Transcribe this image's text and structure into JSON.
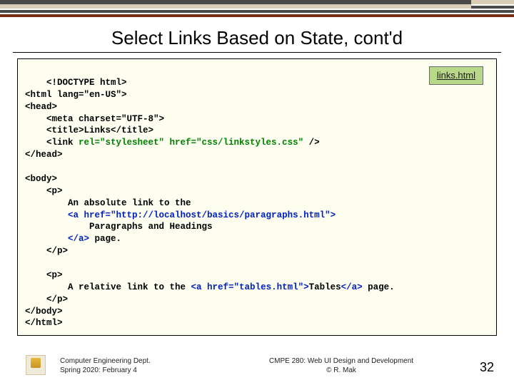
{
  "title": "Select Links Based on State, cont'd",
  "filename_badge": "links.html",
  "code": {
    "l01": "<!DOCTYPE html>",
    "l02": "<html lang=\"en-US\">",
    "l03": "<head>",
    "l04": "    <meta charset=\"UTF-8\">",
    "l05": "    <title>Links</title>",
    "l06a": "    <link ",
    "l06b": "rel=\"stylesheet\" href=\"css/linkstyles.css\"",
    "l06c": " />",
    "l07": "</head>",
    "blank1": " ",
    "l08": "<body>",
    "l09": "    <p>",
    "l10": "        An absolute link to the",
    "l11a": "        ",
    "l11b": "<a href=\"http://localhost/basics/paragraphs.html\">",
    "l12": "            Paragraphs and Headings",
    "l13a": "        ",
    "l13b": "</a>",
    "l13c": " page.",
    "l14": "    </p>",
    "blank2": "    ",
    "l15": "    <p>",
    "l16a": "        A relative link to the ",
    "l16b": "<a href=\"tables.html\">",
    "l16c": "Tables",
    "l16d": "</a>",
    "l16e": " page.",
    "l17": "    </p>",
    "l18": "</body>",
    "l19": "</html>"
  },
  "footer": {
    "left_line1": "Computer Engineering Dept.",
    "left_line2": "Spring 2020: February 4",
    "center_line1": "CMPE 280: Web UI Design and Development",
    "center_line2": "© R. Mak",
    "page": "32"
  }
}
